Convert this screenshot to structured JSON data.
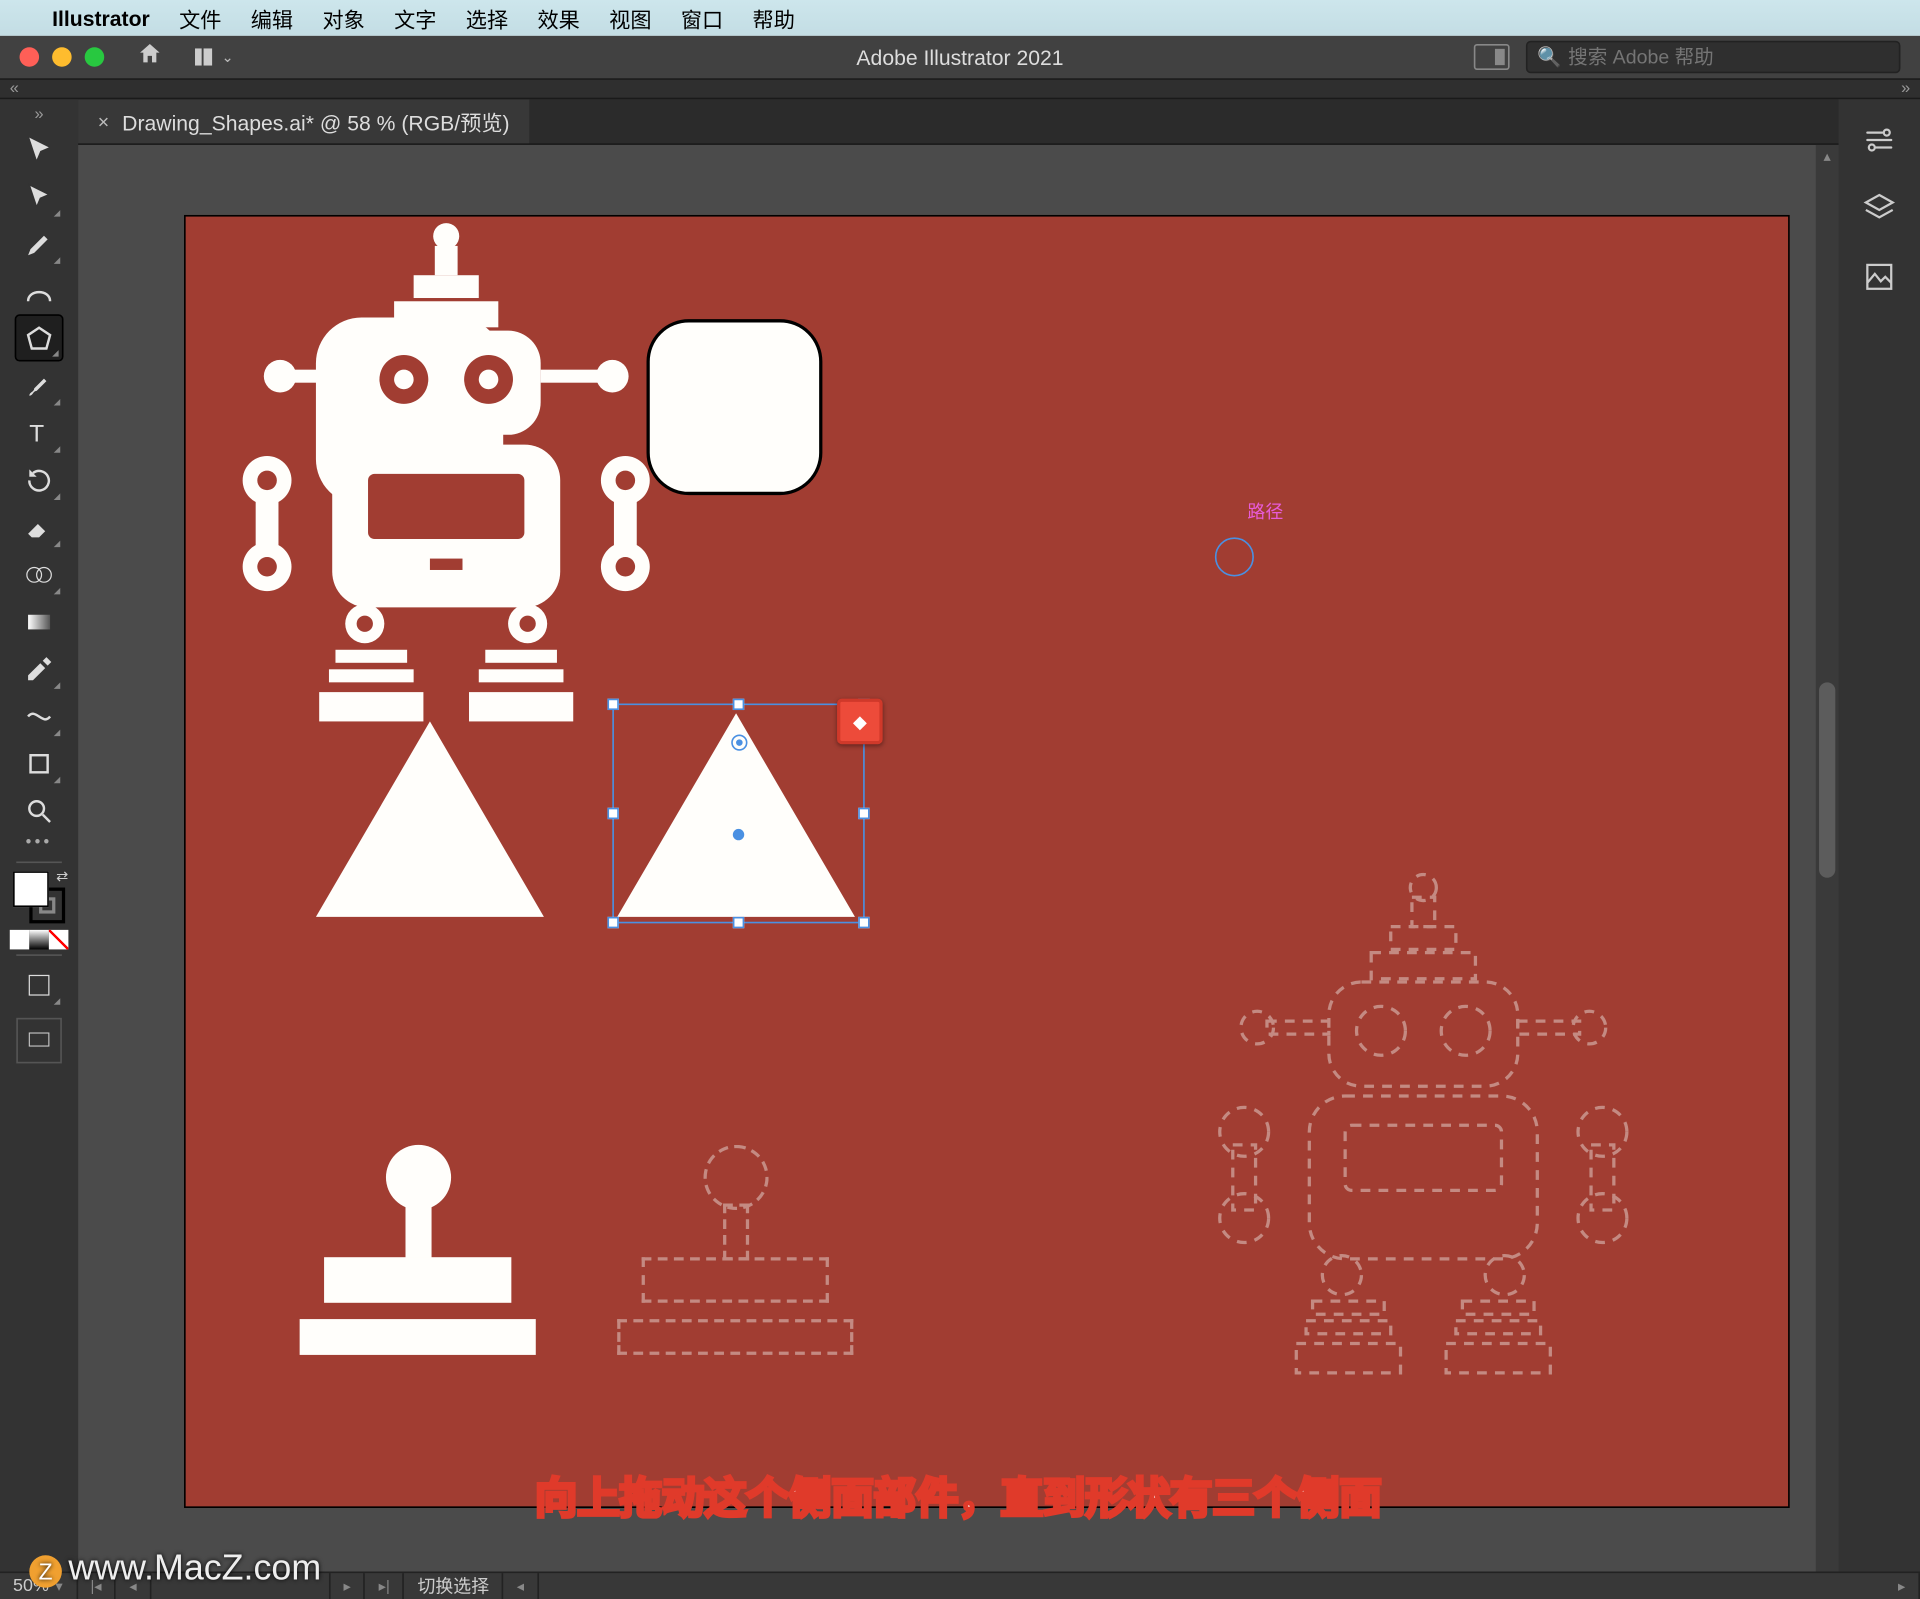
{
  "mac_menu": {
    "app": "Illustrator",
    "items": [
      "文件",
      "编辑",
      "对象",
      "文字",
      "选择",
      "效果",
      "视图",
      "窗口",
      "帮助"
    ]
  },
  "titlebar": {
    "title": "Adobe Illustrator 2021",
    "search_placeholder": "搜索 Adobe 帮助"
  },
  "doc_tab": {
    "label": "Drawing_Shapes.ai* @ 58 % (RGB/预览)"
  },
  "canvas": {
    "path_label": "路径"
  },
  "statusbar": {
    "zoom": "50%",
    "mode": "切换选择"
  },
  "caption": "向上拖动这个侧面部件，直到形状有三个侧面",
  "watermark": "www.MacZ.com",
  "right_panel_icons": [
    "properties-sliders-icon",
    "layers-icon",
    "libraries-icon"
  ]
}
